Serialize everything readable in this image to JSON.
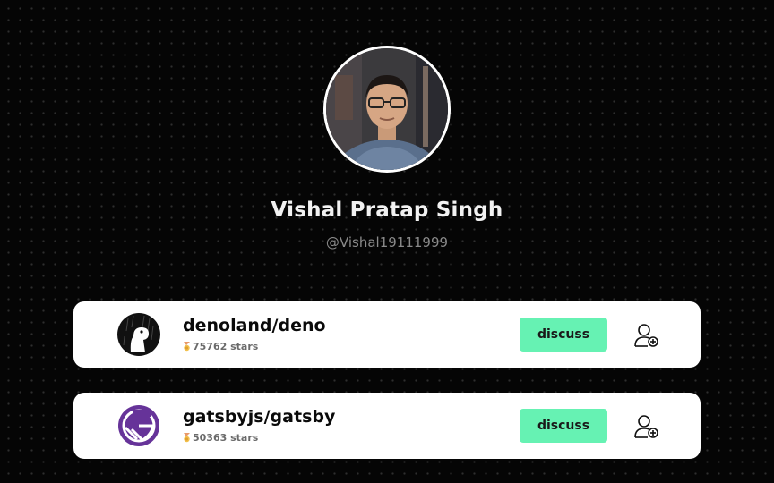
{
  "profile": {
    "name": "Vishal Pratap Singh",
    "handle": "@Vishal19111999",
    "avatar_icon": "user-photo"
  },
  "repos": [
    {
      "name": "denoland/deno",
      "stars_text": "75762 stars",
      "logo_icon": "deno-logo",
      "discuss_label": "discuss",
      "follow_icon": "add-user-icon"
    },
    {
      "name": "gatsbyjs/gatsby",
      "stars_text": "50363 stars",
      "logo_icon": "gatsby-logo",
      "discuss_label": "discuss",
      "follow_icon": "add-user-icon"
    }
  ],
  "colors": {
    "background": "#050505",
    "card": "#ffffff",
    "accent": "#66f2b3",
    "gatsby_purple": "#663399"
  }
}
